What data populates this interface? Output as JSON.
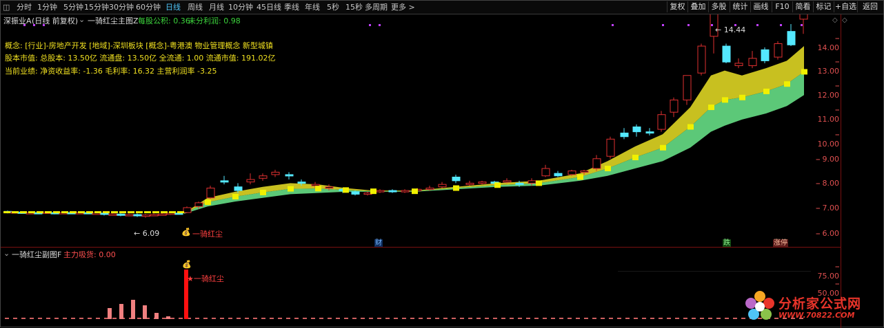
{
  "toolbar": {
    "tabs": [
      "分时",
      "1分钟",
      "5分钟",
      "15分钟",
      "30分钟",
      "60分钟",
      "日线",
      "周线",
      "月线",
      "10分钟",
      "45日线",
      "季线",
      "年线",
      "5秒",
      "15秒",
      "多周期",
      "更多 >"
    ],
    "active": "日线",
    "right": [
      "复权",
      "叠加",
      "多股",
      "统计",
      "画线",
      "F10",
      "简看",
      "标记",
      "+自选",
      "返回"
    ]
  },
  "header": {
    "stock": "深振业A",
    "mode": "(日线 前复权)",
    "indicator": "一骑红尘主图Z",
    "eps_label": "每股公积: 0.36",
    "undist_label": "未分利润: 0.98"
  },
  "info": {
    "concept": "概念: [行业]-房地产开发 [地域]-深圳板块 [概念]-粤港澳 物业管理概念 新型城镇",
    "capital": "股本市值: 总股本: 13.50亿 流通盘: 13.50亿 全流通: 1.00 流通市值: 191.02亿",
    "perf": "当前业绩: 净资收益率: -1.36 毛利率: 16.32 主营利润率 -3.25"
  },
  "price_axis": [
    "14.00",
    "13.00",
    "12.00",
    "11.00",
    "10.00",
    "9.00",
    "8.00",
    "7.00",
    "6.00"
  ],
  "annotations": {
    "high": "14.44",
    "low": "6.09",
    "signal": "一骑红尘",
    "badge_fin": "财",
    "badge_drop": "跌",
    "badge_limit": "涨停"
  },
  "sub": {
    "title": "一骑红尘副图F",
    "value_label": "主力吸货: 0.00",
    "signal": "一骑红尘",
    "axis": [
      "75.00",
      "50.00"
    ]
  },
  "watermark": {
    "line1": "分析家公式网",
    "line2": "WWW.70822.COM"
  },
  "colors": {
    "up": "#e03030",
    "down": "#54e8ff",
    "band_upper": "#c8c020",
    "band_lower": "#5cc878",
    "ma": "#f0f000"
  }
}
